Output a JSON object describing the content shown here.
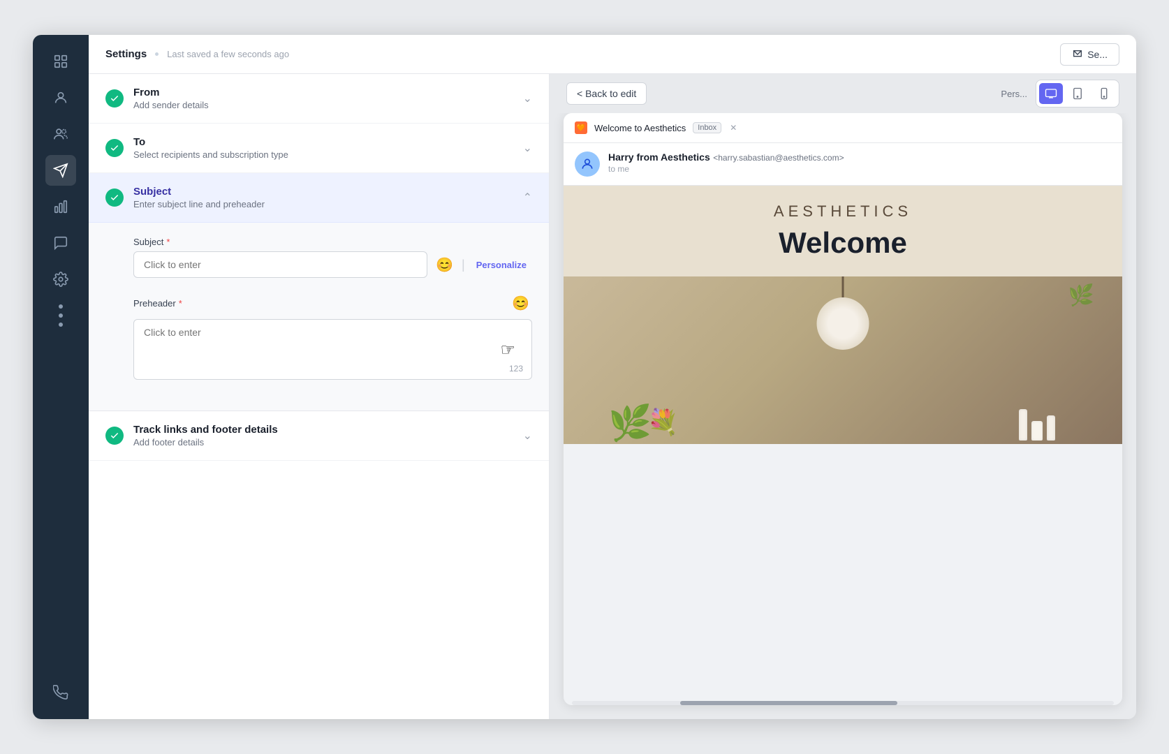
{
  "topbar": {
    "title": "Settings",
    "saved_text": "Last saved a few seconds ago",
    "send_label": "Se..."
  },
  "sidebar": {
    "icons": [
      {
        "name": "grid-icon",
        "label": "Dashboard"
      },
      {
        "name": "user-icon",
        "label": "Contacts"
      },
      {
        "name": "users-icon",
        "label": "Segments"
      },
      {
        "name": "send-icon",
        "label": "Campaigns",
        "active": true
      },
      {
        "name": "chart-icon",
        "label": "Analytics"
      },
      {
        "name": "message-icon",
        "label": "Messages"
      },
      {
        "name": "settings-icon",
        "label": "Settings"
      }
    ],
    "phone_icon": "Phone"
  },
  "sections": {
    "from": {
      "title": "From",
      "subtitle": "Add sender details",
      "expanded": false
    },
    "to": {
      "title": "To",
      "subtitle": "Select recipients and subscription type",
      "expanded": false
    },
    "subject": {
      "title": "Subject",
      "subtitle": "Enter subject line and preheader",
      "expanded": true,
      "fields": {
        "subject_label": "Subject",
        "subject_placeholder": "Click to enter",
        "subject_emoji_label": "😊",
        "personalize_label": "Personalize",
        "preheader_label": "Preheader",
        "preheader_placeholder": "Click to enter",
        "preheader_char_count": "123"
      }
    },
    "track": {
      "title": "Track links and footer details",
      "subtitle": "Add footer details",
      "expanded": false
    }
  },
  "preview": {
    "back_label": "< Back to edit",
    "personalize_label": "Pers...",
    "email": {
      "subject_line": "Welcome to Aesthetics",
      "inbox_label": "Inbox",
      "sender_name": "Harry from Aesthetics",
      "sender_email": "<harry.sabastian@aesthetics.com>",
      "sender_to": "to me",
      "brand_name": "AESTHETICS",
      "welcome_text": "Welcome"
    }
  }
}
